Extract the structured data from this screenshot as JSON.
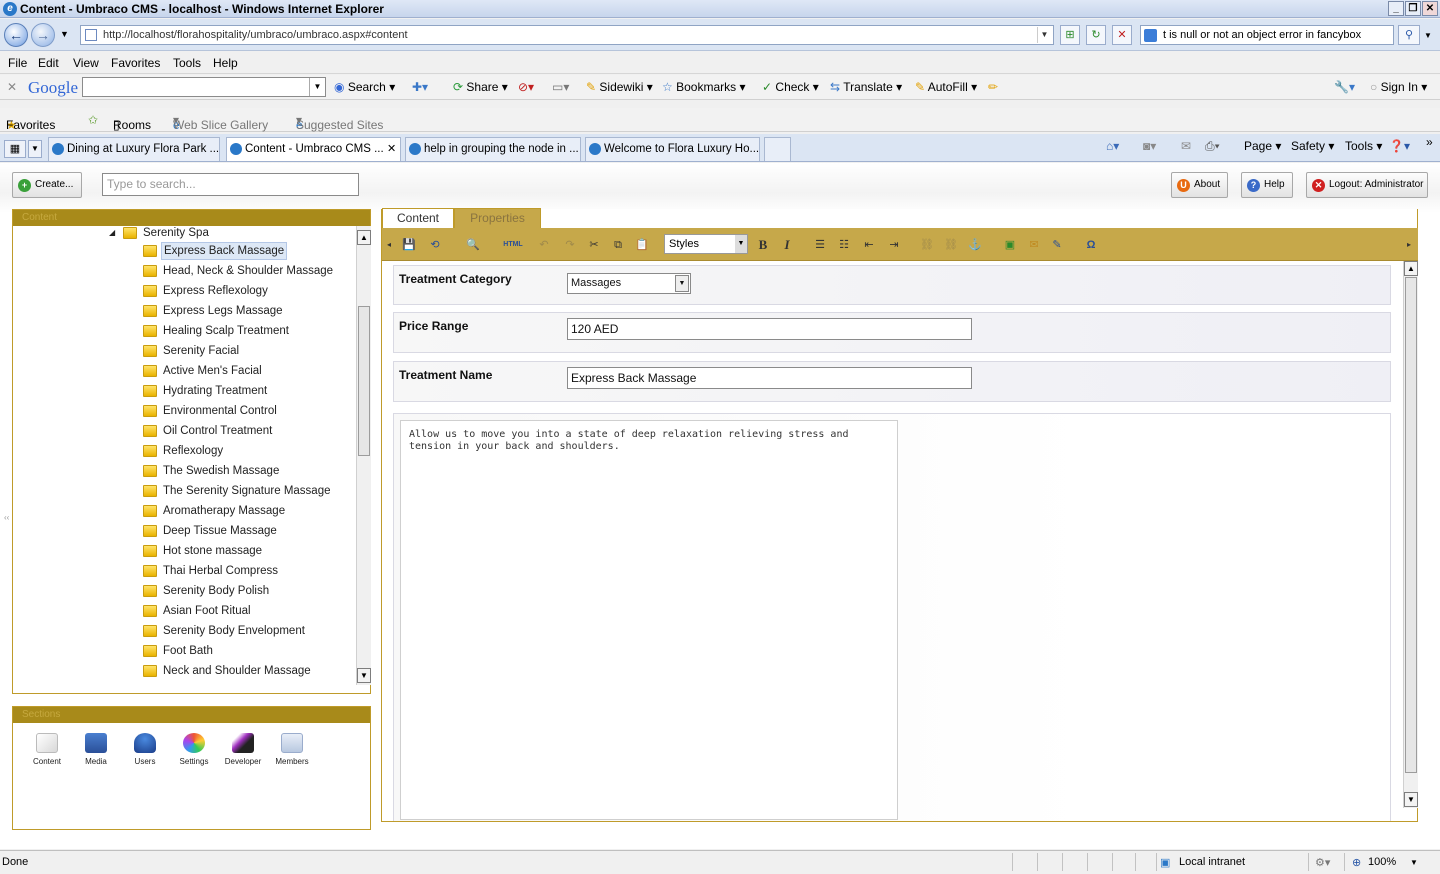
{
  "window": {
    "title": "Content - Umbraco CMS - localhost - Windows Internet Explorer"
  },
  "address_bar": {
    "url": "http://localhost/florahospitality/umbraco/umbraco.aspx#content",
    "search_text": "t is null or not an object error in fancybox"
  },
  "menu": [
    "File",
    "Edit",
    "View",
    "Favorites",
    "Tools",
    "Help"
  ],
  "google_toolbar": {
    "logo": "Google",
    "items": [
      "Search",
      "Share",
      "Sidewiki",
      "Bookmarks",
      "Check",
      "Translate",
      "AutoFill",
      "Sign In"
    ]
  },
  "favorites_bar": {
    "favorites_label": "Favorites",
    "items": [
      "Rooms",
      "Web Slice Gallery",
      "Suggested Sites"
    ]
  },
  "browser_tabs": [
    "Dining at Luxury Flora Park ...",
    "Content - Umbraco CMS ...",
    "help in grouping the node in ...",
    "Welcome to Flora Luxury Ho..."
  ],
  "command_bar": [
    "Page",
    "Safety",
    "Tools"
  ],
  "umbraco": {
    "create_label": "Create...",
    "search_placeholder": "Type to search...",
    "about_label": "About",
    "help_label": "Help",
    "logout_label": "Logout: Administrator",
    "content_panel_title": "Content",
    "sections_panel_title": "Sections",
    "tree_parent": "Serenity Spa",
    "tree_items": [
      "Express Back Massage",
      "Head, Neck & Shoulder Massage",
      "Express Reflexology",
      "Express Legs Massage",
      "Healing Scalp Treatment",
      "Serenity Facial",
      "Active Men's Facial",
      "Hydrating Treatment",
      "Environmental Control",
      "Oil Control Treatment",
      "Reflexology",
      "The Swedish Massage",
      "The Serenity Signature Massage",
      "Aromatherapy Massage",
      "Deep Tissue Massage",
      "Hot stone massage",
      "Thai Herbal Compress",
      "Serenity Body Polish",
      "Asian Foot Ritual",
      "Serenity Body Envelopment",
      "Foot Bath",
      "Neck and Shoulder Massage"
    ],
    "selected_item": "Express Back Massage",
    "sections": [
      "Content",
      "Media",
      "Users",
      "Settings",
      "Developer",
      "Members"
    ],
    "editor_tabs": [
      "Content",
      "Properties"
    ],
    "toolbar": {
      "html_label": "HTML",
      "styles_value": "Styles"
    },
    "fields": {
      "category_label": "Treatment Category",
      "category_value": "Massages",
      "price_label": "Price Range",
      "price_value": "120 AED",
      "name_label": "Treatment Name",
      "name_value": "Express Back Massage"
    },
    "rte_text": "Allow us to move you into a state of deep relaxation relieving stress and tension in your back and shoulders."
  },
  "status_bar": {
    "left": "Done",
    "zone": "Local intranet",
    "zoom": "100%"
  },
  "colors": {
    "panel_gold": "#a88a1a",
    "toolbar_gold": "#c6a84a"
  }
}
